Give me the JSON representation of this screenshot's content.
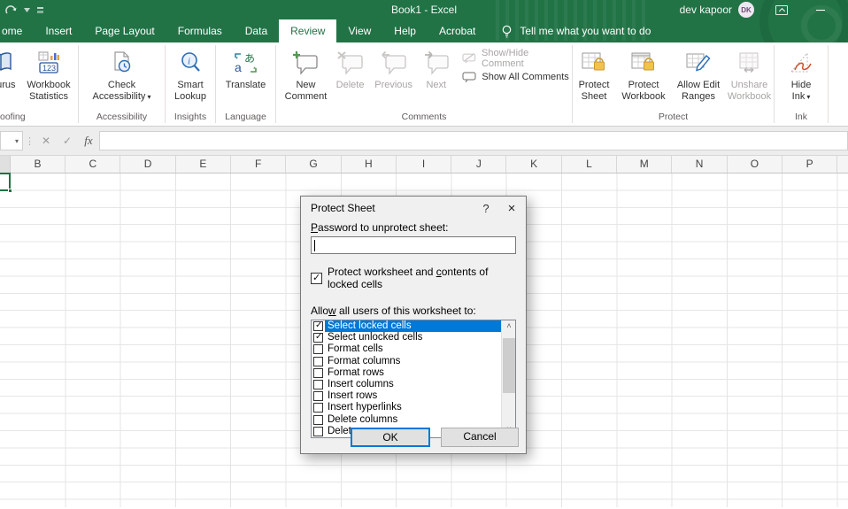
{
  "titlebar": {
    "title": "Book1 - Excel",
    "user": "dev kapoor",
    "initials": "DK"
  },
  "icons": {
    "namebox_caret": "▾",
    "dots": "⋮",
    "cancel": "✕",
    "enter": "✓",
    "fx": "fx",
    "scroll_up": "˄",
    "scroll_down": "˅",
    "help": "?",
    "close": "×"
  },
  "tabs": {
    "home": "ome",
    "insert": "Insert",
    "page_layout": "Page Layout",
    "formulas": "Formulas",
    "data": "Data",
    "review": "Review",
    "view": "View",
    "help": "Help",
    "acrobat": "Acrobat",
    "tell_me": "Tell me what you want to do"
  },
  "ribbon": {
    "proofing": {
      "label": "oofing",
      "thesaurus": "saurus",
      "wb1": "Workbook",
      "wb2": "Statistics"
    },
    "accessibility": {
      "label": "Accessibility",
      "b1": "Check",
      "b2": "Accessibility"
    },
    "insights": {
      "label": "Insights",
      "b1": "Smart",
      "b2": "Lookup"
    },
    "language": {
      "label": "Language",
      "b1": "Translate"
    },
    "comments": {
      "label": "Comments",
      "new1": "New",
      "new2": "Comment",
      "del": "Delete",
      "prev": "Previous",
      "next": "Next",
      "show_hide": "Show/Hide Comment",
      "show_all": "Show All Comments"
    },
    "protect": {
      "label": "Protect",
      "ps1": "Protect",
      "ps2": "Sheet",
      "pw1": "Protect",
      "pw2": "Workbook",
      "ar1": "Allow Edit",
      "ar2": "Ranges",
      "uw1": "Unshare",
      "uw2": "Workbook"
    },
    "ink": {
      "label": "Ink",
      "b1": "Hide",
      "b2": "Ink"
    }
  },
  "sheet": {
    "columns": [
      "B",
      "C",
      "D",
      "E",
      "F",
      "G",
      "H",
      "I",
      "J",
      "K",
      "L",
      "M",
      "N",
      "O",
      "P"
    ]
  },
  "dialog": {
    "title": "Protect Sheet",
    "password_label": {
      "key": "P",
      "rest": "assword to unprotect sheet:"
    },
    "protect_checkbox": {
      "pre": "Protect worksheet and ",
      "key": "c",
      "post": "ontents of locked cells"
    },
    "allow_label": {
      "pre": "Allo",
      "key": "w",
      "post": " all users of this worksheet to:"
    },
    "list": [
      {
        "label": "Select locked cells"
      },
      {
        "label": "Select unlocked cells"
      },
      {
        "label": "Format cells"
      },
      {
        "label": "Format columns"
      },
      {
        "label": "Format rows"
      },
      {
        "label": "Insert columns"
      },
      {
        "label": "Insert rows"
      },
      {
        "label": "Insert hyperlinks"
      },
      {
        "label": "Delete columns"
      },
      {
        "label": "Delete rows"
      }
    ],
    "ok": "OK",
    "cancel": "Cancel"
  }
}
